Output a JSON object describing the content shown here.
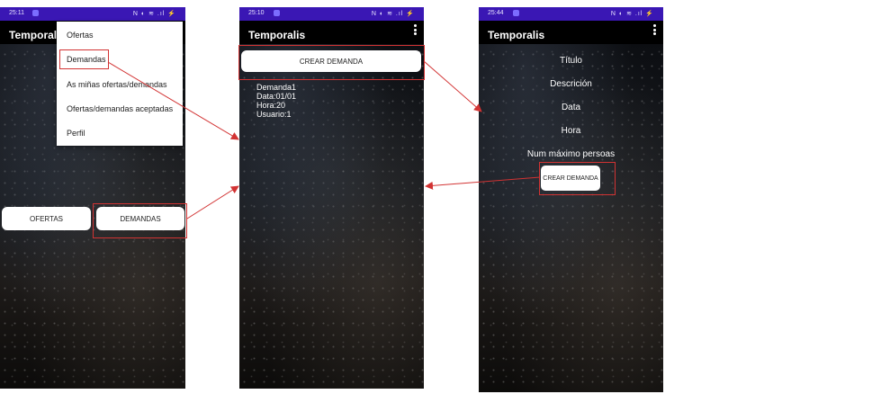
{
  "colors": {
    "status_bar": "#3a17b4",
    "annotation": "#d23333",
    "button_bg": "#ffffff"
  },
  "screen1": {
    "status_time": "25:11",
    "status_icons": "N ◐ ≋ .ıl ⚡",
    "app_title": "Temporalis",
    "menu": [
      "Ofertas",
      "Demandas",
      "As miñas ofertas/demandas",
      "Ofertas/demandas aceptadas",
      "Perfil"
    ],
    "btn_ofertas": "OFERTAS",
    "btn_demandas": "DEMANDAS"
  },
  "screen2": {
    "status_time": "25:10",
    "status_icons": "N ◐ ≋ .ıl ⚡",
    "app_title": "Temporalis",
    "btn_crear": "CREAR DEMANDA",
    "item": {
      "name": "Demanda1",
      "data": "Data:01/01",
      "hora": "Hora:20",
      "usuario": "Usuario:1"
    }
  },
  "screen3": {
    "status_time": "25:44",
    "status_icons": "N ◐ ≋ .ıl ⚡",
    "app_title": "Temporalis",
    "fields": [
      "Título",
      "Descrición",
      "Data",
      "Hora",
      "Num máximo persoas"
    ],
    "btn_crear": "CREAR DEMANDA"
  }
}
